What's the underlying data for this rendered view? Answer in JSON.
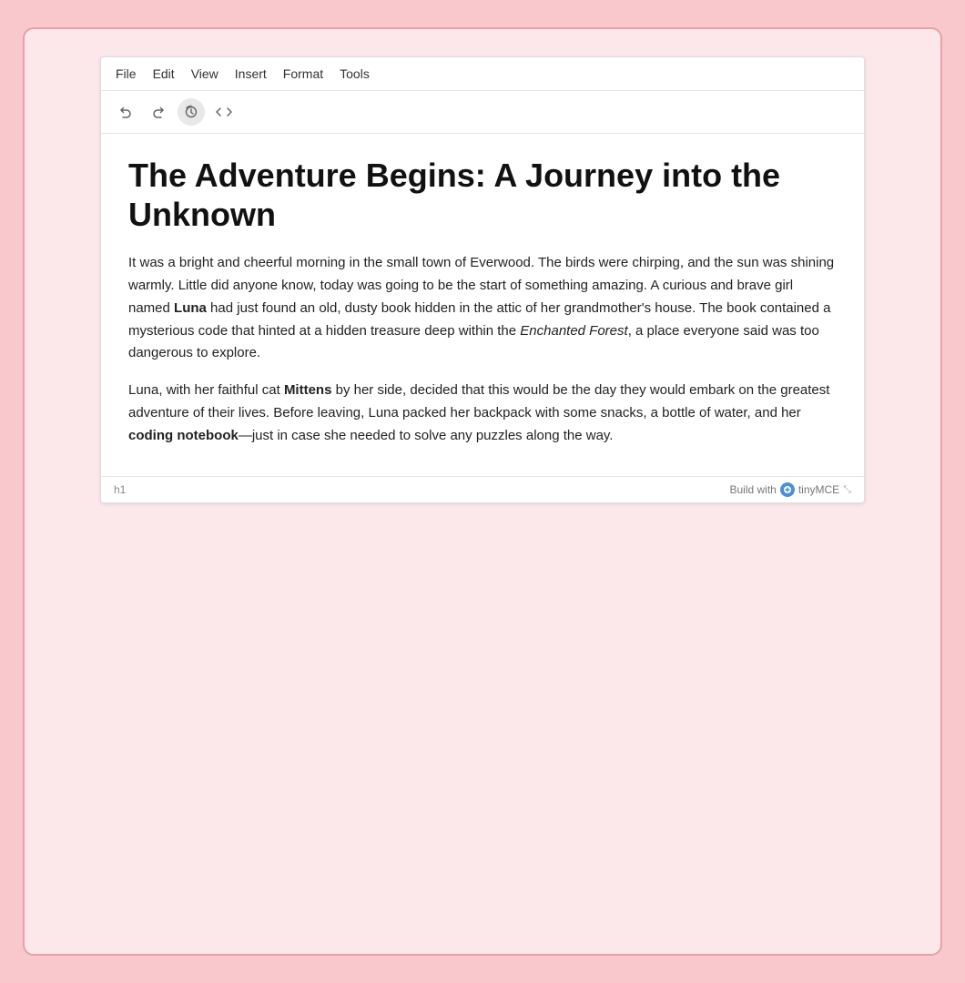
{
  "menuBar": {
    "items": [
      "File",
      "Edit",
      "View",
      "Insert",
      "Format",
      "Tools"
    ]
  },
  "toolbar": {
    "undoLabel": "↩",
    "redoLabel": "↪",
    "historyLabel": "⟳",
    "codeLabel": "<>"
  },
  "content": {
    "title": "The Adventure Begins: A Journey into the Unknown",
    "paragraph1": {
      "prefix": "It was a bright and cheerful morning in the small town of Everwood. The birds were chirping, and the sun was shining warmly. Little did anyone know, today was going to be the start of something amazing. A curious and brave girl named ",
      "bold1": "Luna",
      "middle": " had just found an old, dusty book hidden in the attic of her grandmother's house. The book contained a mysterious code that hinted at a hidden treasure deep within the ",
      "italic1": "Enchanted Forest",
      "suffix": ", a place everyone said was too dangerous to explore."
    },
    "paragraph2": {
      "prefix": "Luna, with her faithful cat ",
      "bold1": "Mittens",
      "middle": " by her side, decided that this would be the day they would embark on the greatest adventure of their lives. Before leaving, Luna packed her backpack with some snacks, a bottle of water, and her ",
      "bold2": "coding notebook",
      "suffix": "—just in case she needed to solve any puzzles along the way."
    }
  },
  "statusBar": {
    "tag": "h1",
    "buildWith": "Build with",
    "brandName": "tinyMCE",
    "resizeIcon": "⤡"
  }
}
